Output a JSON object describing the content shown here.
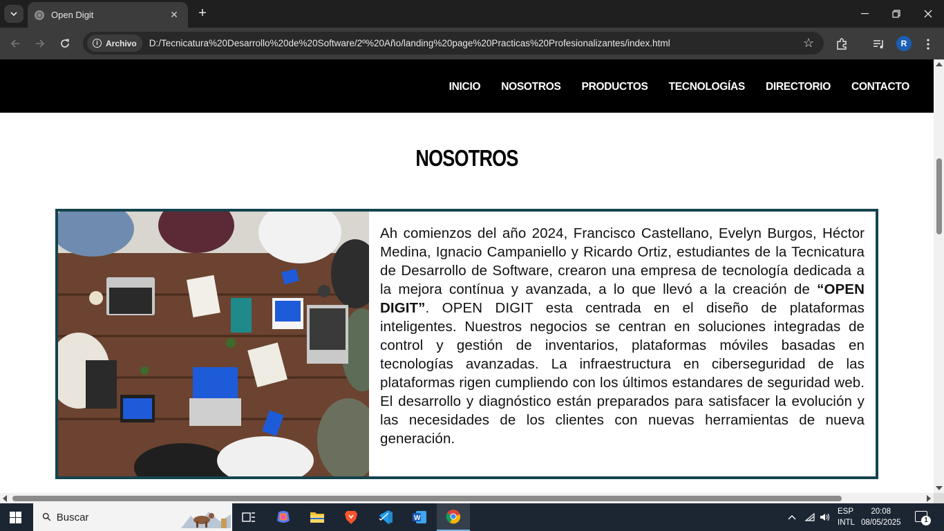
{
  "browser": {
    "tab_title": "Open Digit",
    "address_chip": "Archivo",
    "url": "D:/Tecnicatura%20Desarrollo%20de%20Software/2º%20Año/landing%20page%20Practicas%20Profesionalizantes/index.html",
    "profile_initial": "R"
  },
  "site": {
    "nav": [
      "INICIO",
      "NOSOTROS",
      "PRODUCTOS",
      "TECNOLOGÍAS",
      "DIRECTORIO",
      "CONTACTO"
    ],
    "section_title": "NOSOTROS",
    "about": {
      "text_before": "Ah comienzos del año 2024, Francisco Castellano, Evelyn Burgos, Héctor Medina, Ignacio Campaniello y Ricardo Ortiz, estudiantes de la Tecnicatura de Desarrollo de Software, crearon una empresa de tecnología dedicada a la mejora contínua y avanzada, a lo que llevó a la creación de ",
      "brand_highlight": "“OPEN DIGIT”",
      "text_after": ". OPEN DIGIT esta centrada en el diseño de plataformas inteligentes. Nuestros negocios se centran en soluciones integradas de control y gestión de inventarios, plataformas móviles basadas en tecnologías avanzadas. La infraestructura en ciberseguridad de las plataformas rigen cumpliendo con los últimos estandares de seguridad web. El desarrollo y diagnóstico están preparados para satisfacer la evolución y las necesidades de los clientes con nuevas herramientas de nueva generación."
    },
    "accent_color": "#13444e"
  },
  "taskbar": {
    "search_placeholder": "Buscar",
    "lang_line1": "ESP",
    "lang_line2": "INTL",
    "time": "20:08",
    "date": "08/05/2025",
    "notification_count": "1"
  }
}
